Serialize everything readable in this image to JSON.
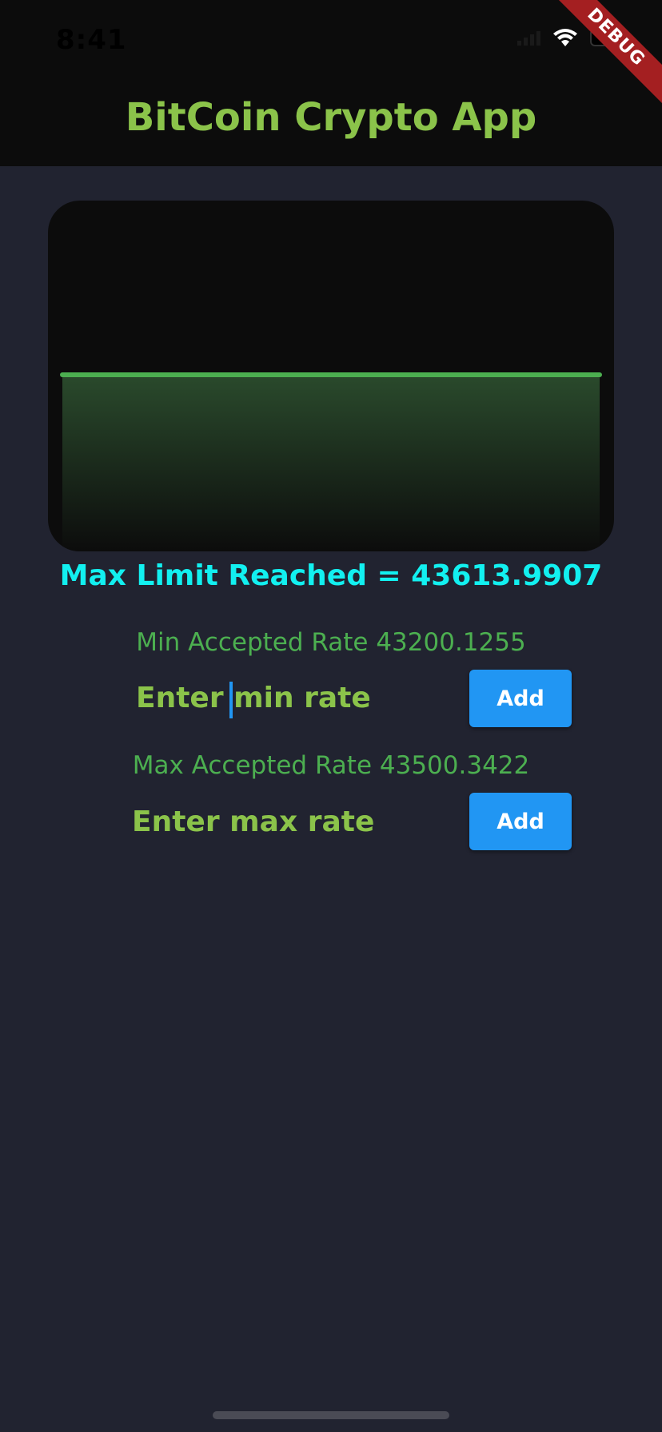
{
  "status_bar": {
    "time": "8:41",
    "icons": [
      "signal-icon",
      "wifi-icon",
      "battery-icon"
    ]
  },
  "app": {
    "title": "BitCoin Crypto App",
    "debug_banner": "DEBUG"
  },
  "chart_data": {
    "type": "area",
    "x": [
      0,
      1,
      2,
      3,
      4,
      5,
      6,
      7,
      8,
      9
    ],
    "values": [
      43613.9907,
      43613.9907,
      43613.9907,
      43613.9907,
      43613.9907,
      43613.9907,
      43613.9907,
      43613.9907,
      43613.9907,
      43613.9907
    ],
    "title": "",
    "xlabel": "",
    "ylabel": "",
    "grid": false,
    "line_color": "#4caf50",
    "fill_color_top": "#2a4a2c",
    "fill_color_bottom": "#0c0c0c"
  },
  "limit_message": "Max Limit Reached = 43613.9907",
  "min_rate": {
    "label": "Min Accepted Rate 43200.1255",
    "placeholder": "Enter min rate",
    "button_label": "Add"
  },
  "max_rate": {
    "label": "Max Accepted Rate 43500.3422",
    "placeholder": "Enter max rate",
    "button_label": "Add"
  },
  "colors": {
    "background": "#212330",
    "app_bar": "#0c0c0c",
    "title": "#8bc34a",
    "limit_text": "#12f0f0",
    "rate_label": "#4caf50",
    "button": "#2196f3"
  }
}
